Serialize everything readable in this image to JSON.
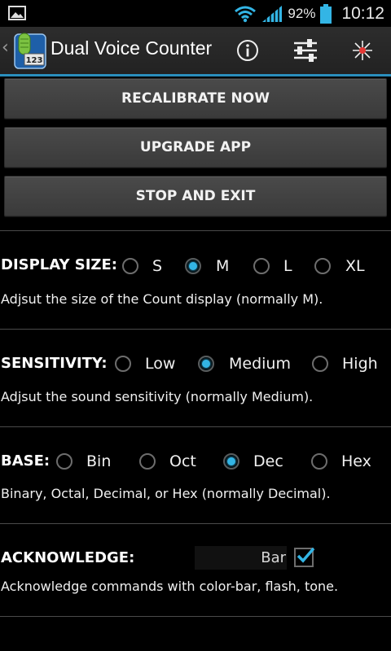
{
  "status_bar": {
    "battery_percent": "92%",
    "time": "10:12",
    "icons": [
      "picture-icon",
      "wifi-icon",
      "signal-icon",
      "battery-icon"
    ]
  },
  "action_bar": {
    "title": "Dual Voice Counter",
    "app_icon_badge": "123",
    "actions": [
      "info-icon",
      "settings-sliders-icon",
      "flash-icon"
    ]
  },
  "buttons": {
    "recalibrate": "RECALIBRATE NOW",
    "upgrade": "UPGRADE APP",
    "stop": "STOP AND EXIT"
  },
  "display_size": {
    "label": "DISPLAY SIZE:",
    "options": [
      "S",
      "M",
      "L",
      "XL"
    ],
    "selected": "M",
    "description": "Adjsut the size of the Count display (normally M)."
  },
  "sensitivity": {
    "label": "SENSITIVITY:",
    "options": [
      "Low",
      "Medium",
      "High"
    ],
    "selected": "Medium",
    "description": "Adjsut the sound sensitivity (normally Medium)."
  },
  "base": {
    "label": "BASE:",
    "options": [
      "Bin",
      "Oct",
      "Dec",
      "Hex"
    ],
    "selected": "Dec",
    "description": "Binary, Octal, Decimal, or Hex (normally Decimal)."
  },
  "acknowledge": {
    "label": "ACKNOWLEDGE:",
    "field_value": "Bar",
    "checked": true,
    "description": "Acknowledge commands with color-bar, flash, tone."
  },
  "colors": {
    "accent": "#33b5e5",
    "actionbar_underline": "#2a8fbd",
    "button_bg": "#424242",
    "background": "#000000"
  }
}
